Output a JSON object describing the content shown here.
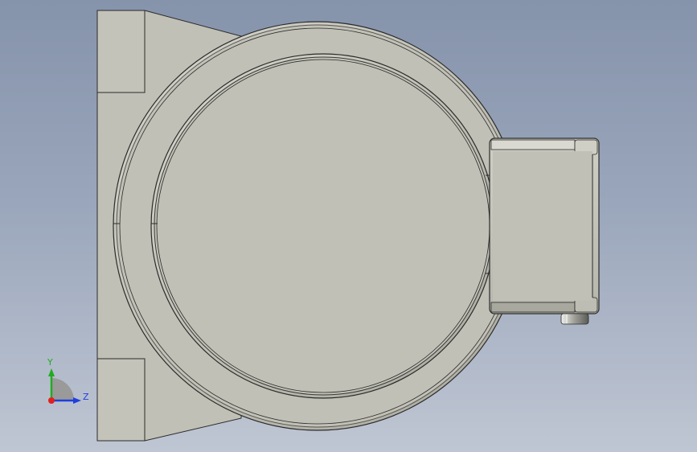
{
  "triad": {
    "y_label": "Y",
    "z_label": "Z",
    "y_color": "#22aa22",
    "z_color": "#1f3fdd",
    "x_color": "#e02020"
  },
  "model": {
    "face_color": "#c0c0b6",
    "edge_color": "#2b2b2b",
    "view": "front"
  }
}
